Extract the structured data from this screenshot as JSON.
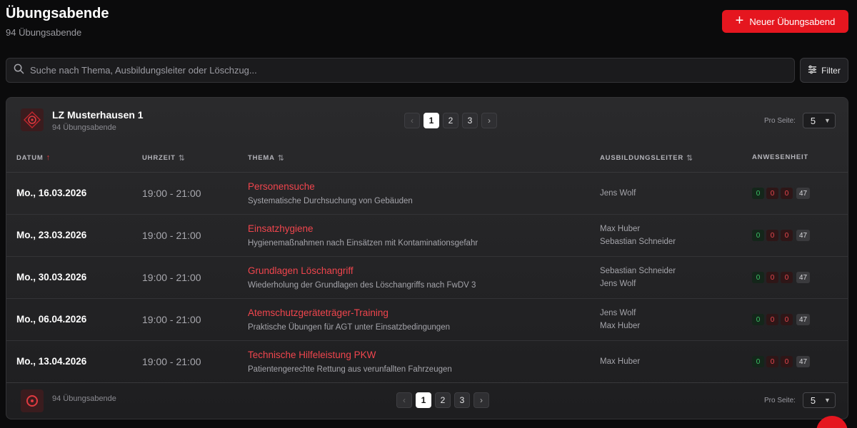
{
  "header": {
    "title": "Übungsabende",
    "subtitle": "94 Übungsabende",
    "new_button_label": "Neuer Übungsabend"
  },
  "search": {
    "placeholder": "Suche nach Thema, Ausbildungsleiter oder Löschzug...",
    "value": ""
  },
  "filter_label": "Filter",
  "unit": {
    "name": "LZ Musterhausen 1",
    "count": "94 Übungsabende"
  },
  "pagination": {
    "pages": [
      "1",
      "2",
      "3"
    ],
    "active": "1",
    "prev": "‹",
    "next": "›"
  },
  "per_page": {
    "label": "Pro Seite:",
    "value": "5"
  },
  "columns": {
    "date": "DATUM",
    "time": "UHRZEIT",
    "theme": "THEMA",
    "lead": "AUSBILDUNGSLEITER",
    "attendance": "ANWESENHEIT"
  },
  "rows": [
    {
      "date": "Mo., 16.03.2026",
      "time": "19:00 - 21:00",
      "title": "Personensuche",
      "desc": "Systematische Durchsuchung von Gebäuden",
      "leads": [
        "Jens Wolf"
      ],
      "att": [
        "0",
        "0",
        "0",
        "47"
      ]
    },
    {
      "date": "Mo., 23.03.2026",
      "time": "19:00 - 21:00",
      "title": "Einsatzhygiene",
      "desc": "Hygienemaßnahmen nach Einsätzen mit Kontaminationsgefahr",
      "leads": [
        "Max Huber",
        "Sebastian Schneider"
      ],
      "att": [
        "0",
        "0",
        "0",
        "47"
      ]
    },
    {
      "date": "Mo., 30.03.2026",
      "time": "19:00 - 21:00",
      "title": "Grundlagen Löschangriff",
      "desc": "Wiederholung der Grundlagen des Löschangriffs nach FwDV 3",
      "leads": [
        "Sebastian Schneider",
        "Jens Wolf"
      ],
      "att": [
        "0",
        "0",
        "0",
        "47"
      ]
    },
    {
      "date": "Mo., 06.04.2026",
      "time": "19:00 - 21:00",
      "title": "Atemschutzgeräteträger-Training",
      "desc": "Praktische Übungen für AGT unter Einsatzbedingungen",
      "leads": [
        "Jens Wolf",
        "Max Huber"
      ],
      "att": [
        "0",
        "0",
        "0",
        "47"
      ]
    },
    {
      "date": "Mo., 13.04.2026",
      "time": "19:00 - 21:00",
      "title": "Technische Hilfeleistung PKW",
      "desc": "Patientengerechte Rettung aus verunfallten Fahrzeugen",
      "leads": [
        "Max Huber"
      ],
      "att": [
        "0",
        "0",
        "0",
        "47"
      ]
    }
  ],
  "footer": {
    "count": "94 Übungsabende"
  },
  "colors": {
    "accent": "#e5161f",
    "title_red": "#f0454d",
    "present_green": "#3cc266"
  },
  "icons": {
    "search": "search-icon",
    "filter": "sliders-icon",
    "plus": "plus-icon",
    "sort_asc": "arrow-up-icon",
    "sort_both": "sort-icon",
    "chevron": "chevron-down-icon"
  }
}
